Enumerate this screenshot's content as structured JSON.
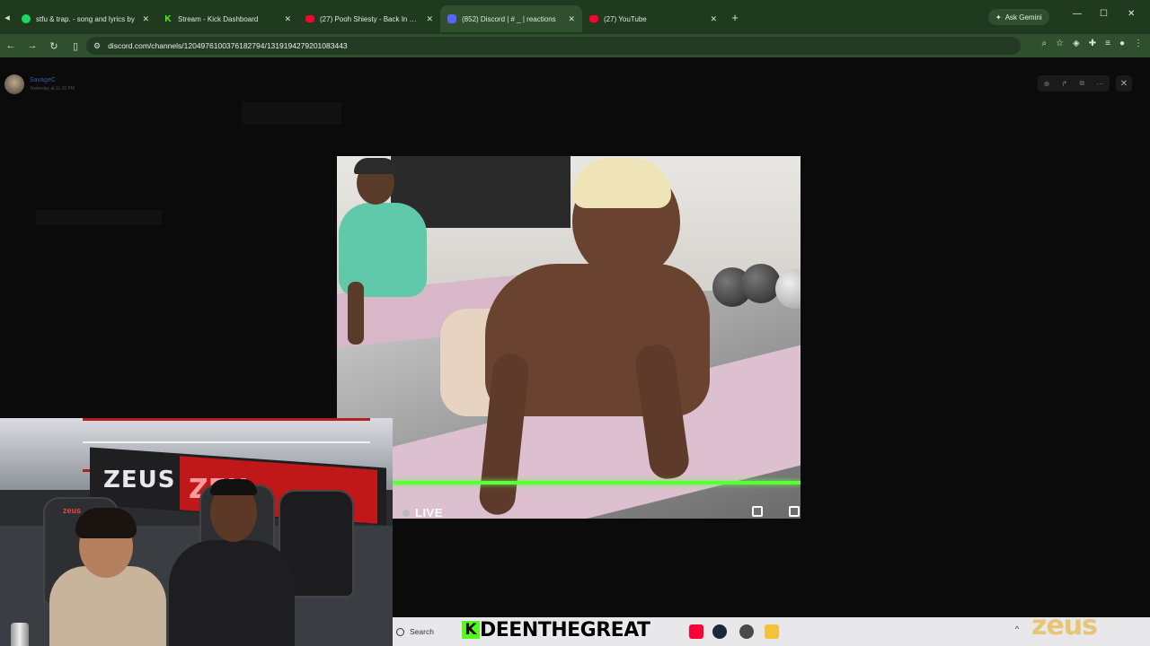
{
  "browser": {
    "tabs": [
      {
        "title": "stfu & trap. - song and lyrics by",
        "favicon": "spotify-icon",
        "active": false
      },
      {
        "title": "Stream - Kick Dashboard",
        "favicon": "kick-icon",
        "active": false
      },
      {
        "title": "(27) Pooh Shiesty - Back In Bloo",
        "favicon": "youtube-icon",
        "active": false
      },
      {
        "title": "(852) Discord | # _ | reactions",
        "favicon": "discord-icon",
        "active": true
      },
      {
        "title": "(27) YouTube",
        "favicon": "youtube-icon",
        "active": false
      }
    ],
    "new_tab": "+",
    "gemini_label": "Ask Gemini",
    "url": "discord.com/channels/1204976100376182794/1319194279201083443",
    "theme_color": "#1f3a1f"
  },
  "discord": {
    "author": "SavageC",
    "timestamp": "Yesterday at 11:20 PM"
  },
  "video": {
    "live_label": "LIVE",
    "progress_color": "#5dff3d"
  },
  "overlay": {
    "cam_banner_left": "ZEUS",
    "cam_banner_right": "ZEU",
    "chair_logo": "zeus",
    "streamer_badge": "K",
    "streamer_name": "DEENTHEGREAT",
    "brand_logo": "zeus"
  },
  "taskbar": {
    "search_placeholder": "Search",
    "tray_chevron": "^"
  }
}
